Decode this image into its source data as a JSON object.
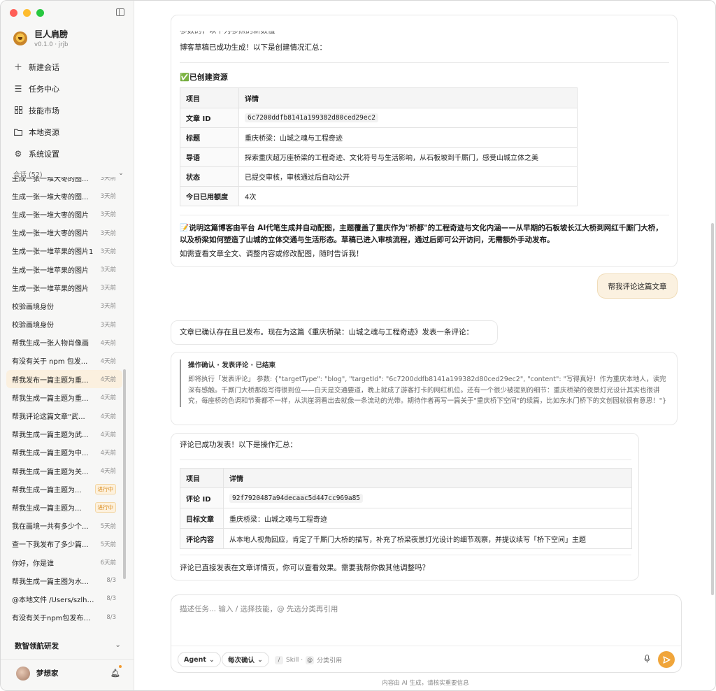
{
  "app": {
    "name": "巨人肩膀",
    "version": "v0.1.0 · jrjb"
  },
  "nav": [
    {
      "icon": "plus-icon",
      "label": "新建会话"
    },
    {
      "icon": "list-icon",
      "label": "任务中心"
    },
    {
      "icon": "grid-icon",
      "label": "技能市场"
    },
    {
      "icon": "folder-icon",
      "label": "本地资源"
    },
    {
      "icon": "gear-icon",
      "label": "系统设置"
    }
  ],
  "sessions": {
    "header": "会话 (52)",
    "items": [
      {
        "title": "生成一张一堆大枣的图...",
        "time": "3天前"
      },
      {
        "title": "生成一张一堆大枣的图...",
        "time": "3天前"
      },
      {
        "title": "生成一张一堆大枣的图片",
        "time": "3天前"
      },
      {
        "title": "生成一张一堆大枣的图片",
        "time": "3天前"
      },
      {
        "title": "生成一张一堆苹果的图片1",
        "time": "3天前"
      },
      {
        "title": "生成一张一堆苹果的图片",
        "time": "3天前"
      },
      {
        "title": "生成一张一堆苹果的图片",
        "time": "3天前"
      },
      {
        "title": "校验画境身份",
        "time": "3天前"
      },
      {
        "title": "校验画境身份",
        "time": "3天前"
      },
      {
        "title": "帮我生成一张人物肖像画",
        "time": "4天前"
      },
      {
        "title": "有没有关于 npm 包发...",
        "time": "4天前"
      },
      {
        "title": "帮我发布一篇主题为重...",
        "time": "4天前",
        "active": true
      },
      {
        "title": "帮我生成一篇主题为重...",
        "time": "4天前"
      },
      {
        "title": "帮我评论这篇文章“武...",
        "time": "4天前"
      },
      {
        "title": "帮我生成一篇主题为武...",
        "time": "4天前"
      },
      {
        "title": "帮我生成一篇主题为中...",
        "time": "4天前"
      },
      {
        "title": "帮我生成一篇主题为关...",
        "time": "4天前"
      },
      {
        "title": "帮我生成一篇主题为...",
        "badge": "进行中"
      },
      {
        "title": "帮我生成一篇主题为...",
        "badge": "进行中"
      },
      {
        "title": "我在画境一共有多少个...",
        "time": "5天前"
      },
      {
        "title": "查一下我发布了多少篇...",
        "time": "5天前"
      },
      {
        "title": "你好，你是谁",
        "time": "6天前"
      },
      {
        "title": "帮我生成一篇主图为水世...",
        "time": "8/3"
      },
      {
        "title": "@本地文件 /Users/szlh0...",
        "time": "8/3"
      },
      {
        "title": "有没有关于npm包发布到...",
        "time": "8/3"
      }
    ]
  },
  "team": {
    "name": "数智领航研发"
  },
  "user": {
    "name": "梦想家"
  },
  "chat": {
    "truncated_top": "参数的，以下为参照的新数值",
    "msg1": {
      "intro": "博客草稿已成功生成！以下是创建情况汇总：",
      "section_title": "✅已创建资源",
      "headers": [
        "项目",
        "详情"
      ],
      "rows": [
        {
          "k": "文章 ID",
          "v": "6c7200ddfb8141a199382d80ced29ec2",
          "code": true
        },
        {
          "k": "标题",
          "v": "重庆桥梁：山城之魂与工程奇迹"
        },
        {
          "k": "导语",
          "v": "探索重庆超万座桥梁的工程奇迹、文化符号与生活影响，从石板坡到千厮门，感受山城立体之美"
        },
        {
          "k": "状态",
          "v": "已提交审核，审核通过后自动公开"
        },
        {
          "k": "今日已用额度",
          "v": "4次"
        }
      ],
      "note": "📝说明这篇博客由平台 AI代笔生成并自动配图，主题覆盖了重庆作为\"桥都\"的工程奇迹与文化内涵——从早期的石板坡长江大桥到网红千厮门大桥，以及桥梁如何塑造了山城的立体交通与生活形态。草稿已进入审核流程，通过后即可公开访问，无需额外手动发布。",
      "footer": "如需查看文章全文、调整内容或修改配图，随时告诉我！"
    },
    "user_msg": "帮我评论这篇文章",
    "msg2": "文章已确认存在且已发布。现在为这篇《重庆桥梁：山城之魂与工程奇迹》发表一条评论：",
    "tool": {
      "header": "操作确认 · 发表评论 · 已结束",
      "body": "即将执行「发表评论」 参数: {\"targetType\": \"blog\", \"targetId\": \"6c7200ddfb8141a199382d80ced29ec2\", \"content\": \"写得真好！作为重庆本地人，读完深有感触。千厮门大桥那段写得很到位——白天是交通要道，晚上就成了游客打卡的网红机位。还有一个很少被提到的细节：重庆桥梁的夜景灯光设计其实也很讲究，每座桥的色调和节奏都不一样，从洪崖洞看出去就像一条流动的光带。期待作者再写一篇关于\"重庆桥下空间\"的续篇，比如东水门桥下的文创园就很有意思！\"}"
    },
    "msg3": {
      "intro": "评论已成功发表！以下是操作汇总：",
      "headers": [
        "项目",
        "详情"
      ],
      "rows": [
        {
          "k": "评论 ID",
          "v": "92f7920487a94decaac5d447cc969a85",
          "code": true
        },
        {
          "k": "目标文章",
          "v": "重庆桥梁：山城之魂与工程奇迹"
        },
        {
          "k": "评论内容",
          "v": "从本地人视角回应，肯定了千厮门大桥的描写，补充了桥梁夜景灯光设计的细节观察，并提议续写「桥下空间」主题"
        }
      ],
      "footer": "评论已直接发表在文章详情页，你可以查看效果。需要我帮你做其他调整吗？"
    }
  },
  "composer": {
    "placeholder": "描述任务... 输入 / 选择技能，@ 先选分类再引用",
    "mode": "Agent",
    "confirm": "每次确认",
    "skill_key": "/",
    "skill_label": "Skill ·",
    "ref_key": "@",
    "ref_label": "分类引用"
  },
  "footer": "内容由 AI 生成，请核实重要信息",
  "colors": {
    "accent": "#f0a53a",
    "user_bubble": "#fbf1e0",
    "sidebar": "#f7f7f6"
  }
}
